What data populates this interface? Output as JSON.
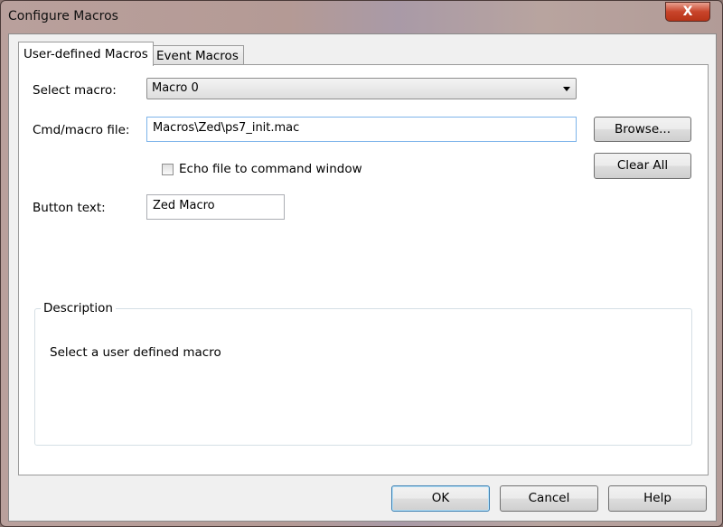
{
  "window": {
    "title": "Configure Macros",
    "close_label": "X"
  },
  "tabs": [
    {
      "label": "User-defined Macros",
      "active": true
    },
    {
      "label": "Event Macros",
      "active": false
    }
  ],
  "form": {
    "select_macro_label": "Select macro:",
    "select_macro_value": "Macro 0",
    "cmd_file_label": "Cmd/macro file:",
    "cmd_file_value": "Macros\\Zed\\ps7_init.mac",
    "browse_label": "Browse...",
    "clear_all_label": "Clear All",
    "echo_label": "Echo file to command window",
    "echo_checked": false,
    "button_text_label": "Button text:",
    "button_text_value": "Zed Macro"
  },
  "description": {
    "title": "Description",
    "text": "Select a user defined macro"
  },
  "footer": {
    "ok": "OK",
    "cancel": "Cancel",
    "help": "Help"
  }
}
